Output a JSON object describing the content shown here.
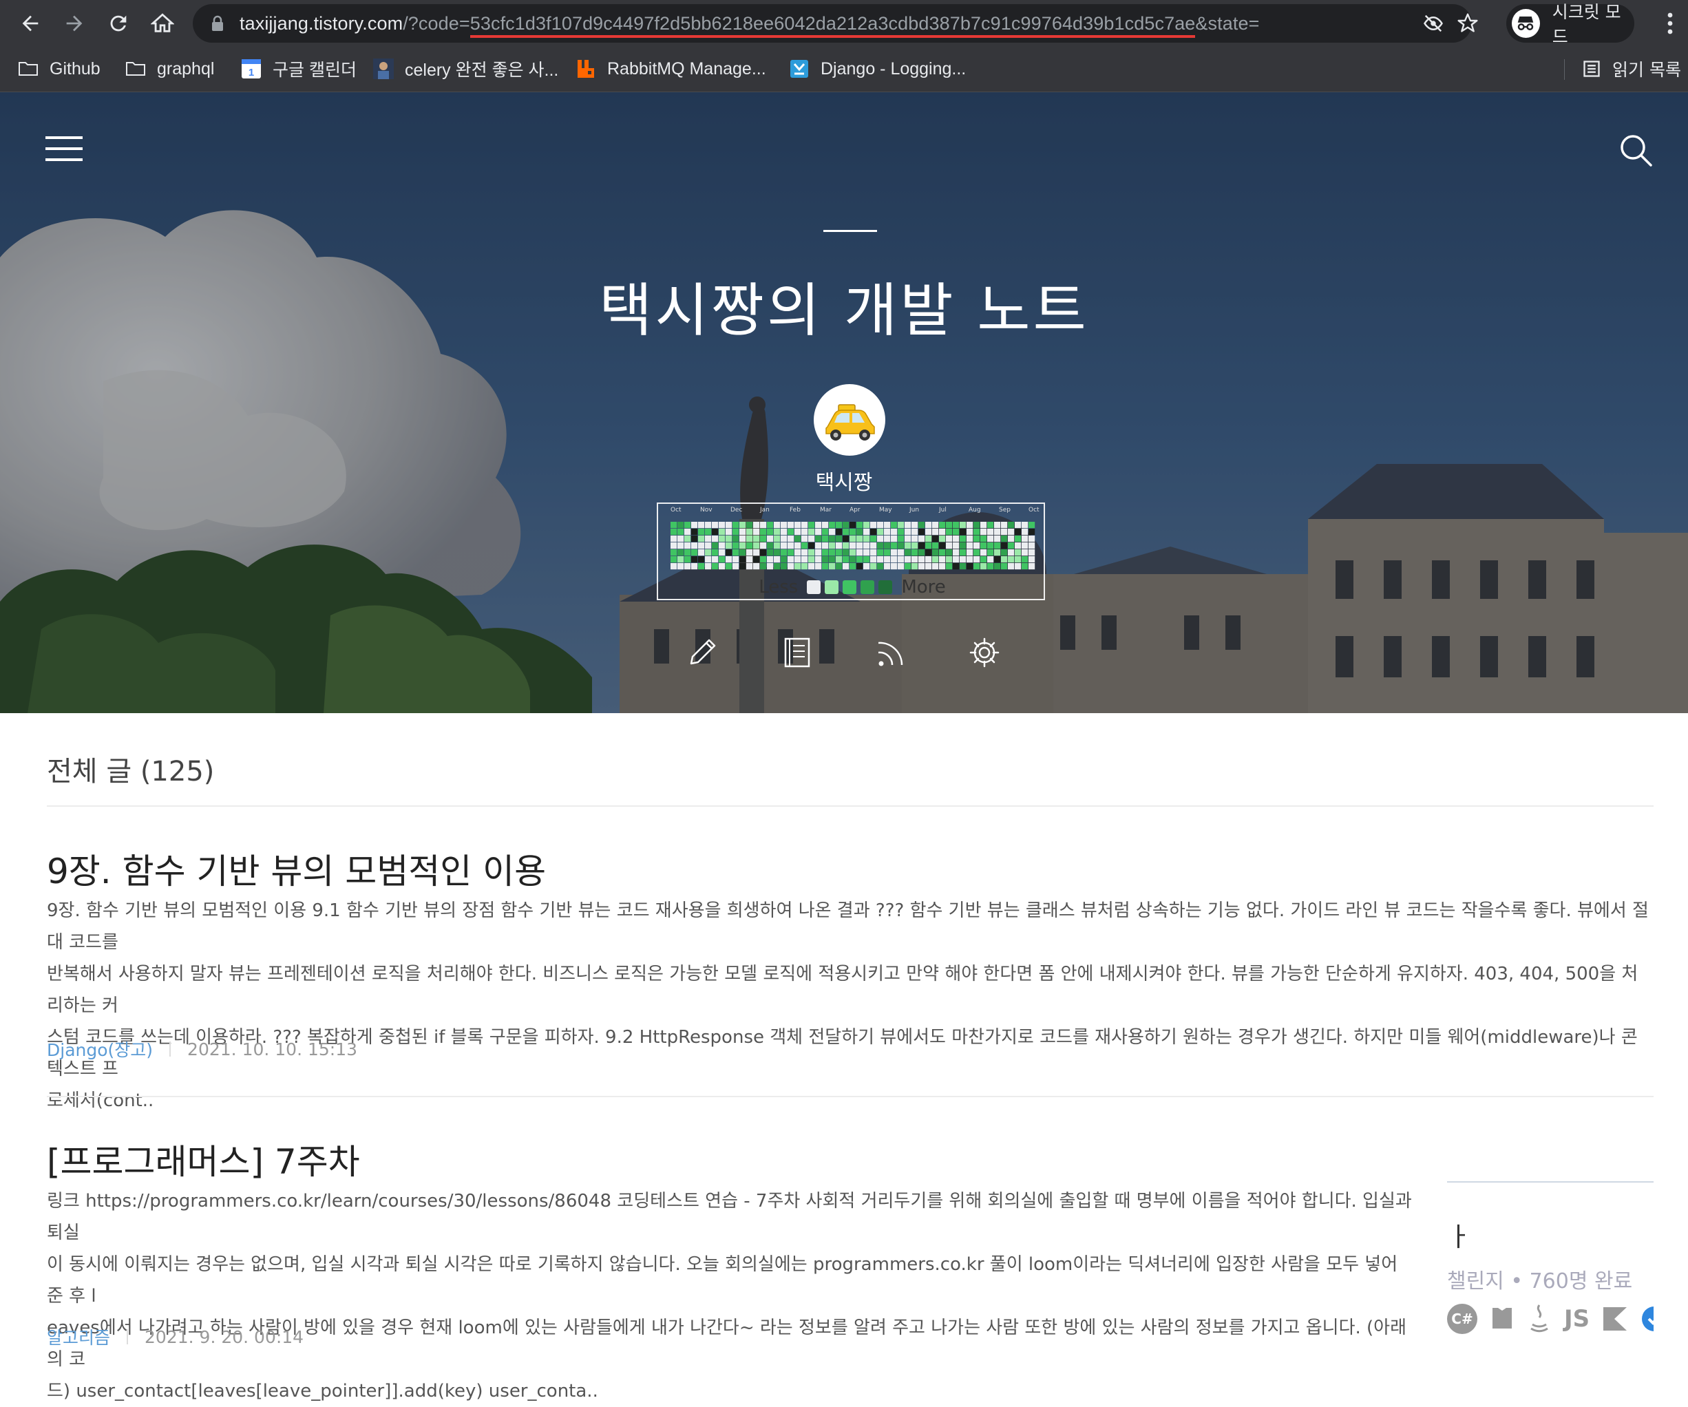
{
  "browser": {
    "url_host": "taxijjang.tistory.com",
    "url_prefix": "/?code=",
    "url_code": "53cfc1d3f107d9c4497f2d5bb6218ee6042da212a3cdbd387b7c91c99764d39b1cd5c7ae",
    "url_suffix": "&state=",
    "incognito_label": "시크릿 모드"
  },
  "bookmarks": [
    {
      "label": "Github",
      "icon": "folder-icon"
    },
    {
      "label": "graphql",
      "icon": "folder-icon"
    },
    {
      "label": "구글 캘린더",
      "icon": "google-calendar-icon"
    },
    {
      "label": "celery 완전 좋은 사...",
      "icon": "profile-favicon-icon"
    },
    {
      "label": "RabbitMQ Manage...",
      "icon": "rabbitmq-icon"
    },
    {
      "label": "Django - Logging...",
      "icon": "django-doc-icon"
    }
  ],
  "reading_list_label": "읽기 목록",
  "hero": {
    "blog_title": "택시짱의 개발 노트",
    "owner_name": "택시짱",
    "grass": {
      "months": [
        "Oct",
        "Nov",
        "Dec",
        "Jan",
        "Feb",
        "Mar",
        "Apr",
        "May",
        "Jun",
        "Jul",
        "Aug",
        "Sep",
        "Oct"
      ],
      "legend_less": "Less",
      "legend_more": "More",
      "colors": [
        "#ebedf0",
        "#9be9a8",
        "#40c463",
        "#30a14e",
        "#216e39"
      ]
    },
    "tools": [
      "pencil-icon",
      "notebook-icon",
      "rss-icon",
      "gear-icon"
    ]
  },
  "content": {
    "section_title": "전체 글 (125)",
    "posts": [
      {
        "title": "9장. 함수 기반 뷰의 모범적인 이용",
        "excerpt": [
          "9장. 함수 기반 뷰의 모범적인 이용 9.1 함수 기반 뷰의 장점 함수 기반 뷰는 코드 재사용을 희생하여 나온 결과 ??? 함수 기반 뷰는 클래스 뷰처럼 상속하는 기능 없다. 가이드 라인 뷰 코드는 작을수록 좋다. 뷰에서 절대 코드를",
          "반복해서 사용하지 말자 뷰는 프레젠테이션 로직을 처리해야 한다. 비즈니스 로직은 가능한 모델 로직에 적용시키고 만약 해야 한다면 폼 안에 내제시켜야 한다. 뷰를 가능한 단순하게 유지하자. 403, 404, 500을 처리하는 커",
          "스텀 코드를 쓰는데 이용하라. ??? 복잡하게 중첩된 if 블록 구문을 피하자. 9.2 HttpResponse 객체 전달하기 뷰에서도 마찬가지로 코드를 재사용하기 원하는 경우가 생긴다. 하지만 미들 웨어(middleware)나 콘텍스트 프",
          "로세서(cont.."
        ],
        "category": "Django(장고)",
        "date": "2021. 10. 10. 15:13"
      },
      {
        "title": "[프로그래머스] 7주차",
        "excerpt": [
          "링크 https://programmers.co.kr/learn/courses/30/lessons/86048 코딩테스트 연습 - 7주차 사회적 거리두기를 위해 회의실에 출입할 때 명부에 이름을 적어야 합니다. 입실과 퇴실",
          "이 동시에 이뤄지는 경우는 없으며, 입실 시각과 퇴실 시각은 따로 기록하지 않습니다. 오늘 회의실에는 programmers.co.kr 풀이 loom이라는 딕셔너리에 입장한 사람을 모두 넣어 준 후 l",
          "eaves에서 나가려고 하는 사람이 방에 있을 경우 현재 loom에 있는 사람들에게 내가 나간다~ 라는 정보를 알려 주고 나가는 사람 또한 방에 있는 사람의 정보를 가지고 옵니다. (아래의 코",
          "드) user_contact[leaves[leave_pointer]].add(key) user_conta.."
        ],
        "category": "알고리즘",
        "date": "2021. 9. 20. 00:14"
      }
    ],
    "side_widget": {
      "heading": "ㅏ",
      "stats": "챌린지  • 760명 완료",
      "langs": [
        "C#",
        "JS"
      ]
    }
  }
}
